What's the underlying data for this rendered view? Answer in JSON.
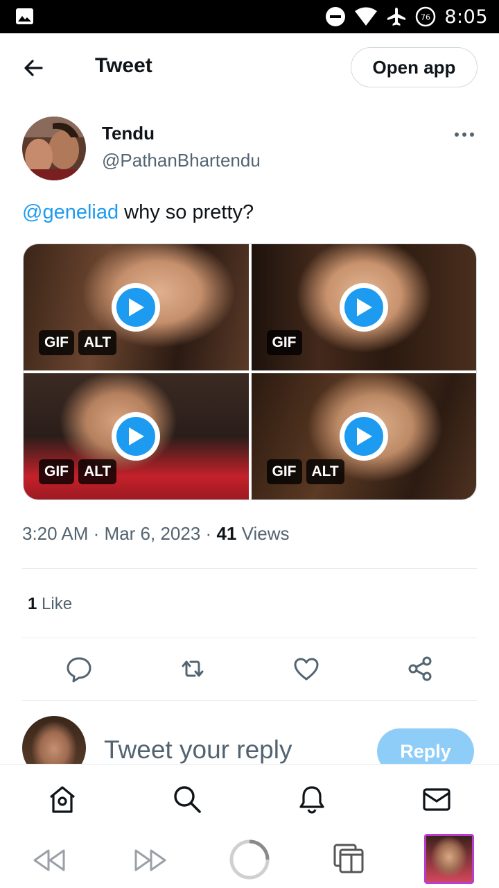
{
  "status_bar": {
    "time": "8:05",
    "battery_level": "76",
    "icons": [
      "gallery-icon",
      "do-not-disturb-icon",
      "wifi-icon",
      "airplane-mode-icon",
      "battery-icon"
    ]
  },
  "header": {
    "title": "Tweet",
    "open_app_label": "Open app"
  },
  "tweet": {
    "author_name": "Tendu",
    "author_handle": "@PathanBhartendu",
    "mention": "@geneliad",
    "text": " why so pretty?",
    "media": [
      {
        "badges": [
          "GIF",
          "ALT"
        ]
      },
      {
        "badges": [
          "GIF"
        ]
      },
      {
        "badges": [
          "GIF",
          "ALT"
        ]
      },
      {
        "badges": [
          "GIF",
          "ALT"
        ]
      }
    ],
    "time": "3:20 AM",
    "separator": "·",
    "date": "Mar 6, 2023",
    "views_count": "41",
    "views_label": " Views",
    "likes_count": "1",
    "likes_label": " Like"
  },
  "reply": {
    "placeholder": "Tweet your reply",
    "button_label": "Reply"
  },
  "colors": {
    "accent": "#1d9bf0",
    "text_primary": "#0f1419",
    "text_secondary": "#536471",
    "reply_disabled": "#8ecdf8"
  }
}
